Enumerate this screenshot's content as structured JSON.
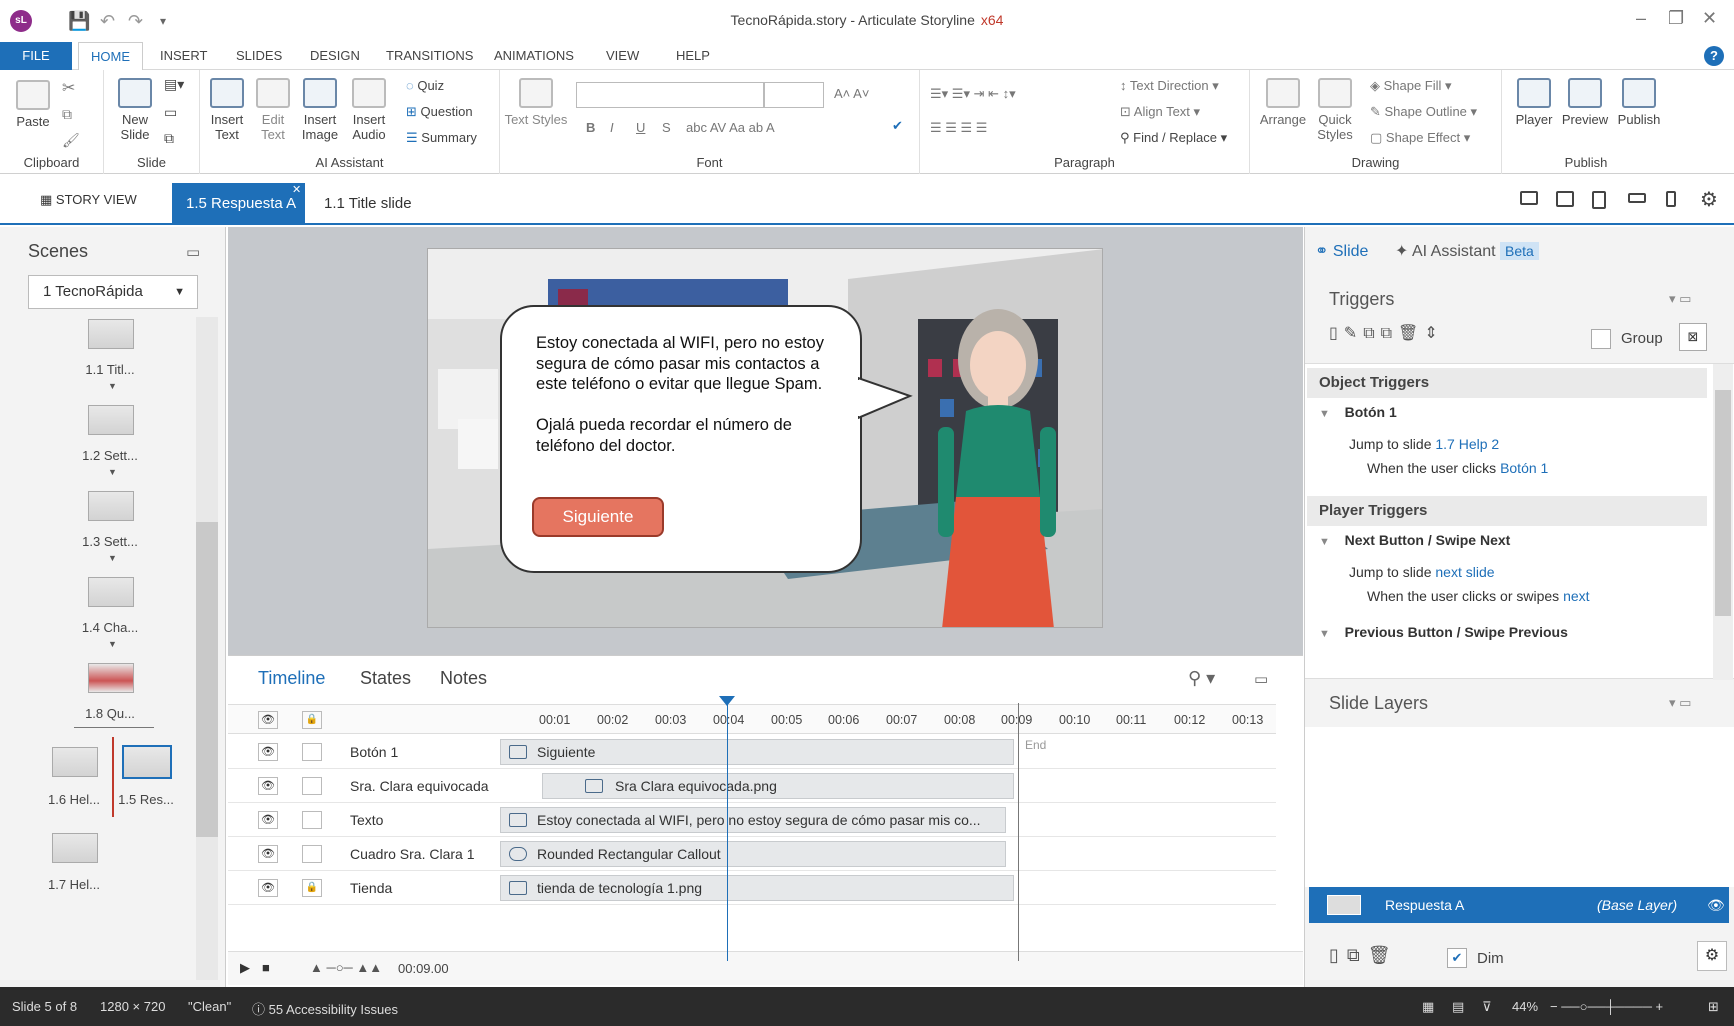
{
  "window": {
    "app_initials": "sL",
    "title": "TecnoRápida.story - Articulate Storyline",
    "arch": "x64"
  },
  "menu": [
    "FILE",
    "HOME",
    "INSERT",
    "SLIDES",
    "DESIGN",
    "TRANSITIONS",
    "ANIMATIONS",
    "VIEW",
    "HELP"
  ],
  "ribbon": {
    "clipboard": {
      "paste": "Paste",
      "label": "Clipboard"
    },
    "slide": {
      "new_slide": "New Slide",
      "label": "Slide"
    },
    "ai": {
      "insert_text": "Insert Text",
      "edit_text": "Edit Text",
      "insert_image": "Insert Image",
      "insert_audio": "Insert Audio",
      "quiz": "Quiz",
      "question": "Question",
      "summary": "Summary",
      "label": "AI Assistant"
    },
    "font": {
      "text_styles": "Text Styles",
      "label": "Font",
      "bold": "B",
      "italic": "I",
      "underline": "U",
      "strike": "S"
    },
    "paragraph": {
      "text_direction": "Text Direction",
      "align_text": "Align Text",
      "find_replace": "Find / Replace",
      "label": "Paragraph"
    },
    "drawing": {
      "arrange": "Arrange",
      "quick_styles": "Quick Styles",
      "shape_fill": "Shape Fill",
      "shape_outline": "Shape Outline",
      "shape_effect": "Shape Effect",
      "label": "Drawing"
    },
    "publish": {
      "player": "Player",
      "preview": "Preview",
      "publish": "Publish",
      "label": "Publish"
    }
  },
  "tabs": {
    "story_view": "STORY VIEW",
    "active": "1.5 Respuesta A",
    "other": "1.1 Title slide"
  },
  "scenes": {
    "title": "Scenes",
    "selected": "1 TecnoRápida",
    "thumbs": [
      {
        "label": "1.1 Titl..."
      },
      {
        "label": "1.2 Sett..."
      },
      {
        "label": "1.3 Sett..."
      },
      {
        "label": "1.4 Cha..."
      },
      {
        "label": "1.8 Qu..."
      },
      {
        "label": "1.6 Hel..."
      },
      {
        "label": "1.5 Res..."
      },
      {
        "label": "1.7 Hel..."
      }
    ]
  },
  "slide": {
    "callout_text": "Estoy conectada al WIFI, pero no estoy segura de cómo pasar mis contactos a este teléfono o evitar que llegue Spam.\n\n Ojalá pueda recordar el número de teléfono del doctor.",
    "button": "Siguiente"
  },
  "timeline": {
    "tabs": [
      "Timeline",
      "States",
      "Notes"
    ],
    "ticks": [
      "00:01",
      "00:02",
      "00:03",
      "00:04",
      "00:05",
      "00:06",
      "00:07",
      "00:08",
      "00:09",
      "00:10",
      "00:11",
      "00:12",
      "00:13"
    ],
    "end_label": "End",
    "rows": [
      {
        "name": "Botón 1",
        "bar": "Siguiente"
      },
      {
        "name": "Sra. Clara equivocada",
        "bar": "Sra Clara equivocada.png"
      },
      {
        "name": "Texto",
        "bar": "Estoy conectada al WIFI, pero no estoy segura de cómo pasar mis co..."
      },
      {
        "name": "Cuadro Sra. Clara 1",
        "bar": "Rounded Rectangular Callout"
      },
      {
        "name": "Tienda",
        "bar": "tienda de tecnología 1.png"
      }
    ],
    "duration": "00:09.00"
  },
  "right": {
    "tab_slide": "Slide",
    "tab_ai": "AI Assistant",
    "beta": "Beta",
    "triggers": "Triggers",
    "group": "Group",
    "object_triggers": "Object Triggers",
    "obj_name": "Botón 1",
    "obj_t1a": "Jump to slide ",
    "obj_t1b": "1.7 Help 2",
    "obj_t2a": "When the user clicks ",
    "obj_t2b": "Botón 1",
    "player_triggers": "Player Triggers",
    "next_name": "Next Button / Swipe Next",
    "next_t1a": "Jump to slide ",
    "next_t1b": "next slide",
    "next_t2a": "When the user clicks or swipes ",
    "next_t2b": "next",
    "prev_name": "Previous Button / Swipe Previous",
    "slide_layers": "Slide Layers",
    "layer_name": "Respuesta A",
    "layer_base": "(Base Layer)",
    "dim": "Dim"
  },
  "status": {
    "slide": "Slide 5 of 8",
    "size": "1280 × 720",
    "theme": "\"Clean\"",
    "accessibility": "55 Accessibility Issues",
    "zoom": "44%"
  }
}
